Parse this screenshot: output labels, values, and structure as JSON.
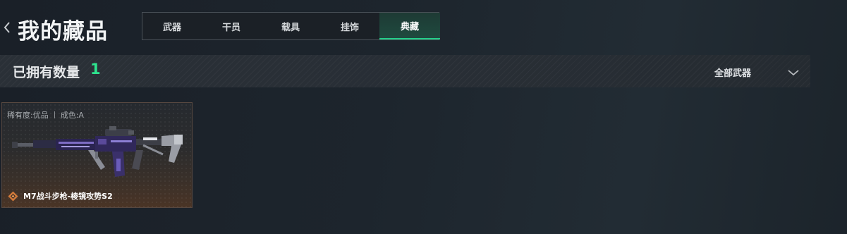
{
  "header": {
    "title": "我的藏品",
    "tabs": [
      {
        "label": "武器",
        "active": false
      },
      {
        "label": "干员",
        "active": false
      },
      {
        "label": "载具",
        "active": false
      },
      {
        "label": "挂饰",
        "active": false
      },
      {
        "label": "典藏",
        "active": true
      }
    ]
  },
  "summary": {
    "owned_label": "已拥有数量",
    "owned_count": "1",
    "filter_label": "全部武器"
  },
  "items": [
    {
      "rarity": "稀有度:优品",
      "condition": "成色:A",
      "name": "M7战斗步枪-棱镜攻势S2"
    }
  ],
  "colors": {
    "accent": "#2ee38e",
    "tab_active_underline": "#23d08a",
    "rarity_icon": "#d27a3a"
  },
  "icons": {
    "back": "chevron-left-icon",
    "filter": "chevron-down-icon",
    "rarity": "rarity-diamond-icon"
  }
}
